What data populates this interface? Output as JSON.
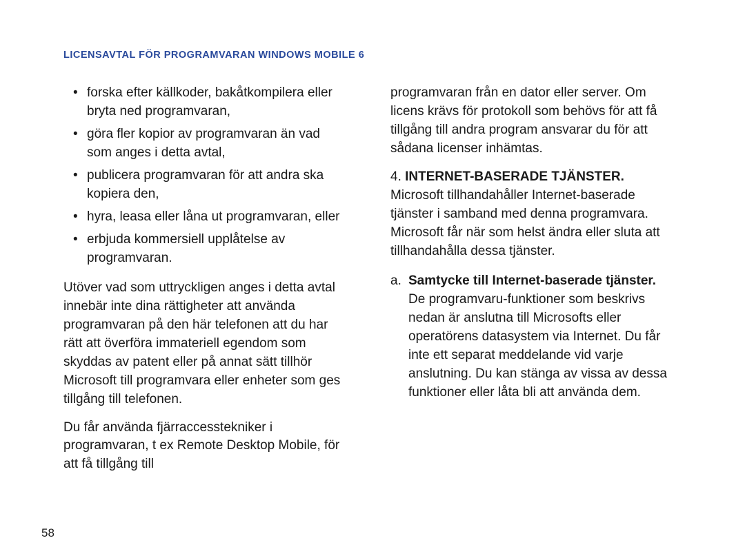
{
  "header": {
    "running_head": "LICENSAVTAL FÖR PROGRAMVARAN WINDOWS MOBILE 6"
  },
  "left": {
    "bullets": [
      "forska efter källkoder, bakåtkompilera eller bryta ned programvaran,",
      "göra fler kopior av programvaran än vad som anges i detta avtal,",
      "publicera programvaran för att andra ska kopiera den,",
      "hyra, leasa eller låna ut programvaran, eller",
      "erbjuda kommersiell upplåtelse av programvaran."
    ],
    "para1": "Utöver vad som uttryckligen anges i detta avtal innebär inte dina rättigheter att använda programvaran på den här telefonen att du har rätt att överföra immateriell egendom som skyddas av patent eller på annat sätt tillhör Microsoft till programvara eller enheter som ges tillgång till telefonen.",
    "para2": "Du får använda fjärraccesstekniker i programvaran, t ex Remote Desktop Mobile, för att få tillgång till"
  },
  "right": {
    "continuation": "programvaran från en dator eller server. Om licens krävs för protokoll som behövs för att få tillgång till andra program ansvarar du för att sådana licenser inhämtas.",
    "section4": {
      "number": "4.",
      "heading": "INTERNET-BASERADE TJÄNSTER.",
      "body": "Microsoft tillhandahåller Internet-baserade tjänster i samband med denna programvara. Microsoft får när som helst ändra eller sluta att tillhandahålla dessa tjänster."
    },
    "sub_a": {
      "label": "a.",
      "heading": "Samtycke till Internet-baserade tjänster.",
      "body": " De programvaru-funktioner som beskrivs nedan är anslutna till Microsofts eller operatörens datasystem via Internet. Du får inte ett separat meddelande vid varje anslutning. Du kan stänga av vissa av dessa funktioner eller låta bli att använda dem."
    }
  },
  "page_number": "58"
}
